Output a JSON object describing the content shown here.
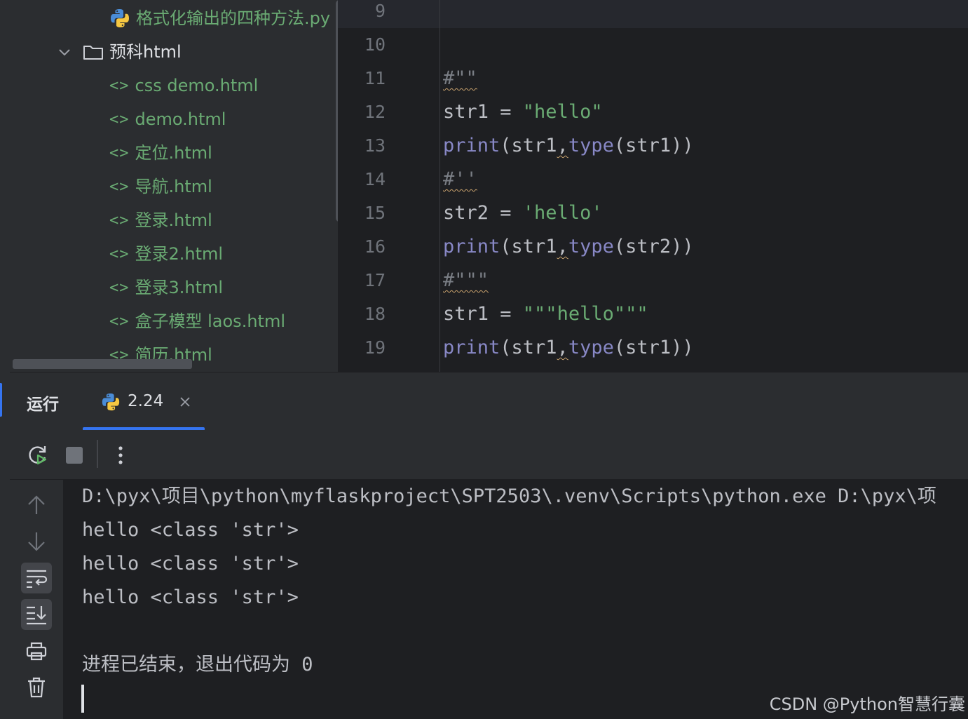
{
  "project_tree": {
    "items": [
      {
        "type": "file",
        "icon": "python-file-icon",
        "label": "格式化输出的四种方法.py"
      },
      {
        "type": "folder",
        "icon": "folder-icon",
        "label": "预科html",
        "expanded": true
      },
      {
        "type": "file",
        "icon": "html-file-icon",
        "label": "css demo.html"
      },
      {
        "type": "file",
        "icon": "html-file-icon",
        "label": "demo.html"
      },
      {
        "type": "file",
        "icon": "html-file-icon",
        "label": "定位.html"
      },
      {
        "type": "file",
        "icon": "html-file-icon",
        "label": "导航.html"
      },
      {
        "type": "file",
        "icon": "html-file-icon",
        "label": "登录.html"
      },
      {
        "type": "file",
        "icon": "html-file-icon",
        "label": "登录2.html"
      },
      {
        "type": "file",
        "icon": "html-file-icon",
        "label": "登录3.html"
      },
      {
        "type": "file",
        "icon": "html-file-icon",
        "label": "盒子模型 laos.html"
      },
      {
        "type": "file",
        "icon": "html-file-icon",
        "label": "简历.html"
      }
    ]
  },
  "editor": {
    "lines": [
      {
        "num": "9",
        "text": ""
      },
      {
        "num": "10",
        "text": ""
      },
      {
        "num": "11",
        "text": "#\"\""
      },
      {
        "num": "12",
        "text": "str1 = \"hello\""
      },
      {
        "num": "13",
        "text": "print(str1,type(str1))"
      },
      {
        "num": "14",
        "text": "#''"
      },
      {
        "num": "15",
        "text": "str2 = 'hello'"
      },
      {
        "num": "16",
        "text": "print(str1,type(str2))"
      },
      {
        "num": "17",
        "text": "#\"\"\""
      },
      {
        "num": "18",
        "text": "str1 = \"\"\"hello\"\"\""
      },
      {
        "num": "19",
        "text": "print(str1,type(str1))"
      }
    ]
  },
  "run_window": {
    "title": "运行",
    "tab": {
      "icon": "python-icon",
      "label": "2.24",
      "close_icon": "close-icon"
    },
    "toolbar": [
      "rerun-icon",
      "stop-icon",
      "more-vertical-icon"
    ],
    "side_toolbar": [
      {
        "icon": "arrow-up-icon",
        "active": false
      },
      {
        "icon": "arrow-down-icon",
        "active": false
      },
      {
        "icon": "soft-wrap-icon",
        "active": true
      },
      {
        "icon": "scroll-to-end-icon",
        "active": true
      },
      {
        "icon": "print-icon",
        "active": false
      },
      {
        "icon": "trash-icon",
        "active": false
      }
    ],
    "console_lines": [
      "D:\\pyx\\项目\\python\\myflaskproject\\SPT2503\\.venv\\Scripts\\python.exe D:\\pyx\\项",
      "hello <class 'str'>",
      "hello <class 'str'>",
      "hello <class 'str'>",
      "",
      "进程已结束，退出代码为 0"
    ]
  },
  "watermark": "CSDN @Python智慧行囊",
  "colors": {
    "background": "#1e1f22",
    "panel": "#2b2d30",
    "accent": "#3574f0",
    "string": "#6aab73",
    "builtin": "#8888c6",
    "text": "#bcbec4"
  }
}
